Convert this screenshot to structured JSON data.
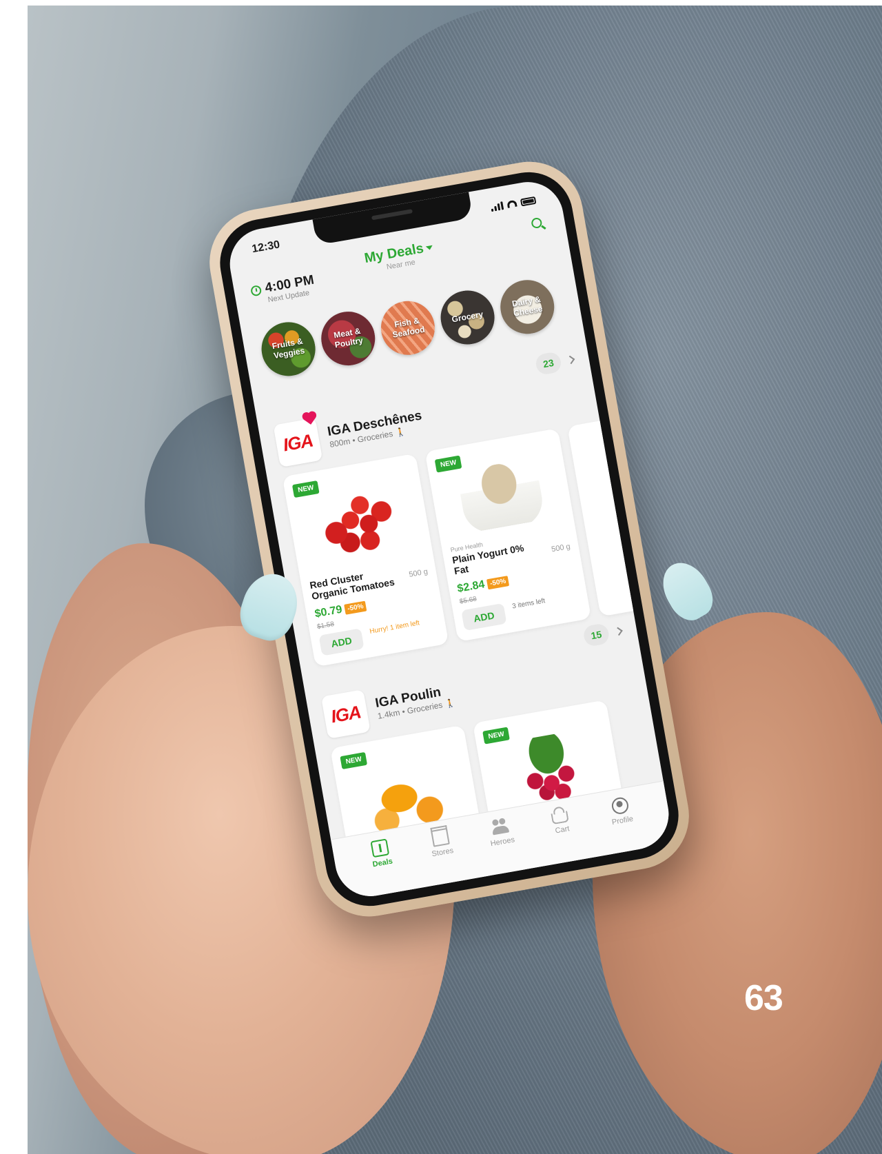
{
  "page_number": "63",
  "status_bar": {
    "time": "12:30"
  },
  "header": {
    "next_update_time": "4:00 PM",
    "next_update_label": "Next Update",
    "title": "My Deals",
    "subtitle": "Near me"
  },
  "categories": [
    {
      "label": "Fruits & Veggies"
    },
    {
      "label": "Meat & Poultry"
    },
    {
      "label": "Fish & Seafood"
    },
    {
      "label": "Grocery"
    },
    {
      "label": "Dairy & Cheese"
    }
  ],
  "stores": [
    {
      "name": "IGA Deschênes",
      "logo_text": "IGA",
      "meta": "800m • Groceries",
      "deal_count": "23",
      "products": [
        {
          "badge": "NEW",
          "brand": "",
          "name": "Red Cluster Organic Tomatoes",
          "weight": "500 g",
          "price": "$0.79",
          "discount": "-50%",
          "old_price": "$1.58",
          "add_label": "ADD",
          "note": "Hurry! 1 item left",
          "image": "tomatoes"
        },
        {
          "badge": "NEW",
          "brand": "Pure Health",
          "name": "Plain Yogurt 0% Fat",
          "weight": "500 g",
          "price": "$2.84",
          "discount": "-50%",
          "old_price": "$5.68",
          "add_label": "ADD",
          "note": "3 items left",
          "image": "yogurt"
        }
      ]
    },
    {
      "name": "IGA Poulin",
      "logo_text": "IGA",
      "meta": "1.4km • Groceries",
      "deal_count": "15",
      "products": [
        {
          "badge": "NEW",
          "image": "orange-juice"
        },
        {
          "badge": "NEW",
          "image": "radishes"
        }
      ]
    }
  ],
  "tabs": [
    {
      "label": "Deals",
      "icon": "deals-icon",
      "active": true
    },
    {
      "label": "Stores",
      "icon": "stores-icon"
    },
    {
      "label": "Heroes",
      "icon": "heroes-icon"
    },
    {
      "label": "Cart",
      "icon": "cart-icon"
    },
    {
      "label": "Profile",
      "icon": "profile-icon"
    }
  ],
  "colors": {
    "accent": "#2da834",
    "discount": "#f39a1d",
    "brand_red": "#e4141b"
  }
}
